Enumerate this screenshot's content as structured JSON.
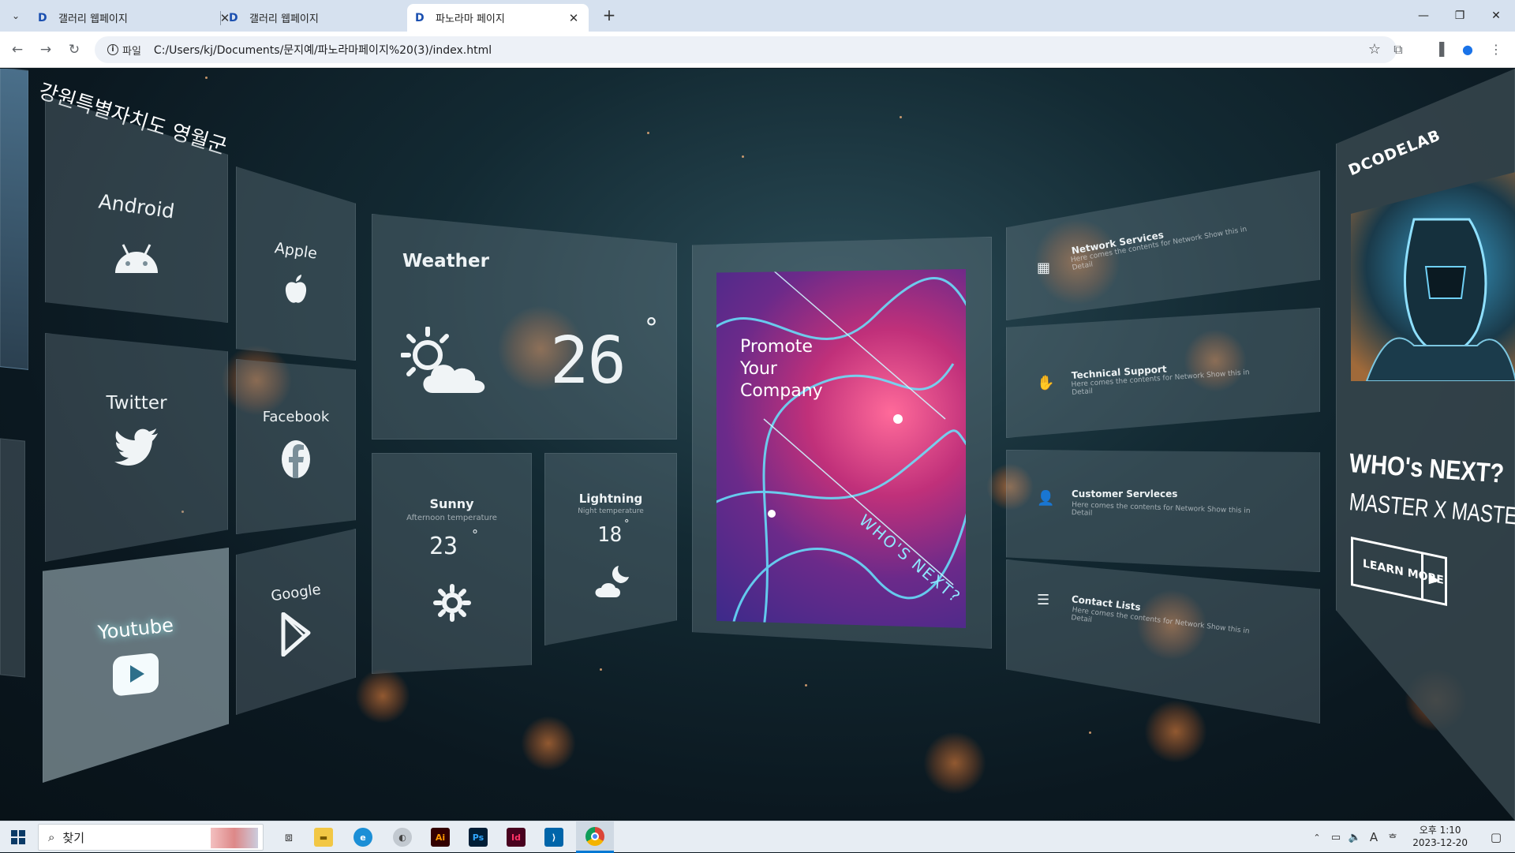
{
  "browser": {
    "tabs": [
      {
        "title": "갤러리 웹페이지",
        "favicon": "D",
        "active": false
      },
      {
        "title": "갤러리 웹페이지",
        "favicon": "D",
        "active": false
      },
      {
        "title": "파노라마 페이지",
        "favicon": "D",
        "active": true
      }
    ],
    "site_info_label": "파일",
    "url": "C:/Users/kj/Documents/문지예/파노라마페이지%20(3)/index.html"
  },
  "page": {
    "region_title": "강원특별자치도 영월군",
    "social": [
      {
        "label": "Android",
        "icon": "android-icon"
      },
      {
        "label": "Apple",
        "icon": "apple-icon"
      },
      {
        "label": "Twitter",
        "icon": "twitter-icon"
      },
      {
        "label": "Facebook",
        "icon": "facebook-icon"
      },
      {
        "label": "Youtube",
        "icon": "youtube-icon"
      },
      {
        "label": "Google",
        "icon": "google-play-icon"
      }
    ],
    "weather": {
      "title": "Weather",
      "temp": "26",
      "deg": "°",
      "sunny": {
        "title": "Sunny",
        "sub": "Afternoon temperature",
        "temp": "23",
        "deg": "°"
      },
      "lightning": {
        "title": "Lightning",
        "sub": "Night temperature",
        "temp": "18",
        "deg": "°"
      }
    },
    "poster": {
      "headline": [
        "Promote",
        "Your",
        "Company"
      ],
      "tagline": "WHO'S NEXT?"
    },
    "services": [
      {
        "title": "Network Services",
        "desc": "Here comes the contents for Network Show this in Detail",
        "icon": "network-icon"
      },
      {
        "title": "Technical Support",
        "desc": "Here comes the contents for Network Show this in Detail",
        "icon": "hand-icon"
      },
      {
        "title": "Customer Servleces",
        "desc": "Here comes the contents for Network Show this in Detail",
        "icon": "person-icon"
      },
      {
        "title": "Contact Lists",
        "desc": "Here comes the contents for Network Show this in Detail",
        "icon": "list-icon"
      }
    ],
    "promo": {
      "brand": "DCODELAB",
      "headline": "WHO's NEXT?",
      "subheadline": "MASTER X MASTER",
      "button": "LEARN MORE"
    }
  },
  "taskbar": {
    "search_placeholder": "찾기",
    "time": "오후 1:10",
    "date": "2023-12-20",
    "apps": [
      "file-explorer-icon",
      "edge-icon",
      "app-icon",
      "illustrator-icon",
      "photoshop-icon",
      "indesign-icon",
      "vscode-icon",
      "chrome-icon"
    ],
    "colors": {
      "accent": "#0078d4",
      "ai": "#ff9a00",
      "ps": "#31a8ff",
      "id": "#ff3366"
    }
  }
}
